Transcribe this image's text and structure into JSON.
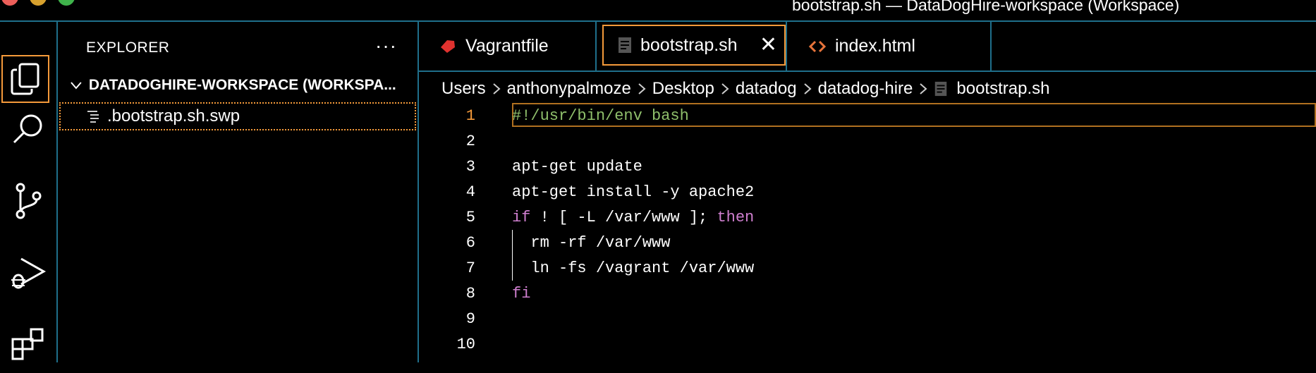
{
  "window": {
    "title": "bootstrap.sh — DataDogHire-workspace (Workspace)"
  },
  "activity_bar": {
    "items": [
      {
        "icon": "files-icon",
        "active": true
      },
      {
        "icon": "search-icon",
        "active": false
      },
      {
        "icon": "source-control-icon",
        "active": false
      },
      {
        "icon": "run-debug-icon",
        "active": false
      },
      {
        "icon": "extensions-icon",
        "active": false
      }
    ]
  },
  "sidebar": {
    "title": "EXPLORER",
    "more_label": "···",
    "workspace_label": "DATADOGHIRE-WORKSPACE (WORKSPA...",
    "files": [
      {
        "name": ".bootstrap.sh.swp",
        "icon": "text-file-icon"
      }
    ]
  },
  "tabs": [
    {
      "label": "Vagrantfile",
      "icon": "ruby-icon",
      "active": false
    },
    {
      "label": "bootstrap.sh",
      "icon": "file-icon",
      "active": true,
      "close_label": "✕"
    },
    {
      "label": "index.html",
      "icon": "html-icon",
      "active": false
    }
  ],
  "breadcrumb": {
    "parts": [
      "Users",
      "anthonypalmoze",
      "Desktop",
      "datadog",
      "datadog-hire"
    ],
    "file": "bootstrap.sh"
  },
  "editor": {
    "current_line": 1,
    "lines": [
      {
        "n": "1",
        "text": "#!/usr/bin/env bash"
      },
      {
        "n": "2",
        "text": ""
      },
      {
        "n": "3",
        "text": "apt-get update"
      },
      {
        "n": "4",
        "text": "apt-get install -y apache2"
      },
      {
        "n": "5",
        "pre": "if",
        "mid": " ! [ -L /var/www ]; ",
        "post": "then"
      },
      {
        "n": "6",
        "text": "  rm -rf /var/www"
      },
      {
        "n": "7",
        "text": "  ln -fs /vagrant /var/www"
      },
      {
        "n": "8",
        "text": "fi"
      },
      {
        "n": "9",
        "text": ""
      },
      {
        "n": "10",
        "text": ""
      }
    ]
  },
  "colors": {
    "accent": "#f59a3a",
    "border": "#1f6f8b",
    "comment": "#8fbf6b",
    "keyword": "#cf7fcf",
    "ruby": "#e0322f",
    "html": "#e8743b"
  }
}
